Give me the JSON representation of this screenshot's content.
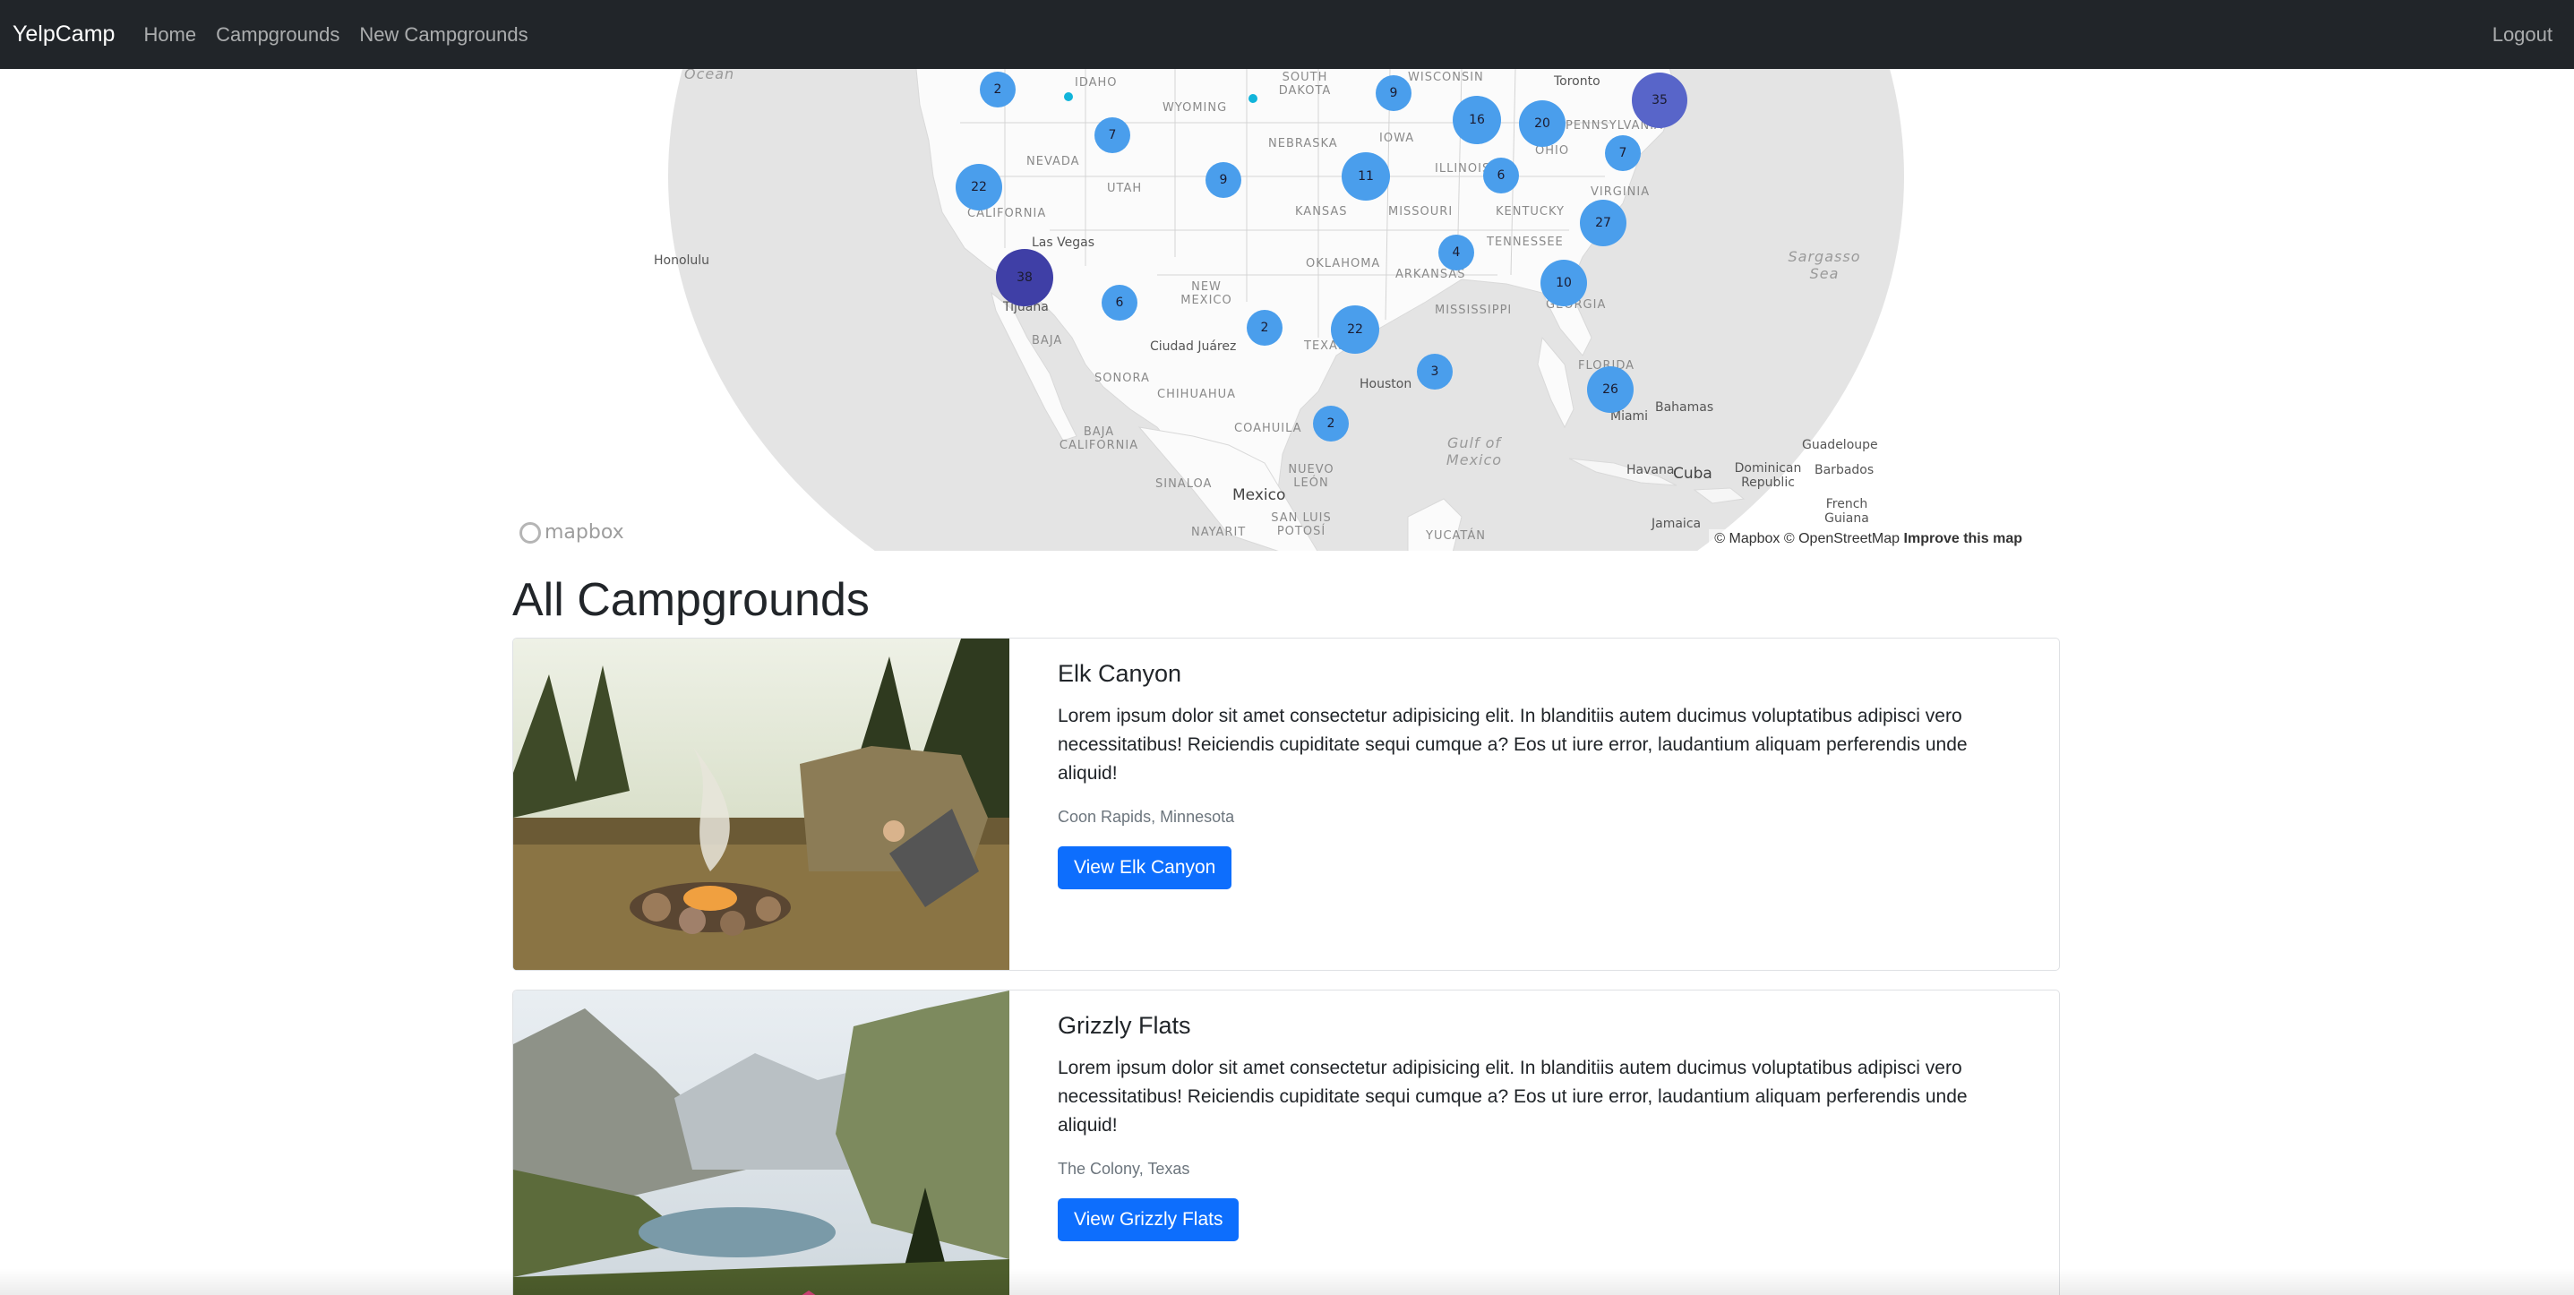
{
  "navbar": {
    "brand": "YelpCamp",
    "links": [
      "Home",
      "Campgrounds",
      "New Campgrounds"
    ],
    "logout": "Logout"
  },
  "map": {
    "labels": {
      "ocean": "Ocean",
      "idaho": "IDAHO",
      "wyoming": "WYOMING",
      "south_dakota": "SOUTH DAKOTA",
      "wisconsin": "WISCONSIN",
      "toronto": "Toronto",
      "nevada": "NEVADA",
      "utah": "UTAH",
      "nebraska": "NEBRASKA",
      "iowa": "IOWA",
      "illinois": "ILLINOIS",
      "pennsylvania": "PENNSYLVANIA",
      "ohio": "OHIO",
      "california": "CALIFORNIA",
      "kansas": "KANSAS",
      "missouri": "MISSOURI",
      "kentucky": "KENTUCKY",
      "virginia": "VIRGINIA",
      "honolulu": "Honolulu",
      "las_vegas": "Las Vegas",
      "oklahoma": "OKLAHOMA",
      "arkansas": "ARKANSAS",
      "tennessee": "TENNESSEE",
      "sargasso": "Sargasso Sea",
      "new_mexico": "NEW MEXICO",
      "mississippi": "MISSISSIPPI",
      "georgia": "GEORGIA",
      "tijuana": "Tijuana",
      "ciudad_juarez": "Ciudad Juárez",
      "texas": "TEXAS",
      "baja": "BAJA",
      "sonora": "SONORA",
      "chihuahua": "CHIHUAHUA",
      "houston": "Houston",
      "florida": "FLORIDA",
      "bahamas": "Bahamas",
      "miami": "Miami",
      "baja_california": "BAJA CALIFORNIA",
      "coahuila": "COAHUILA",
      "gulf": "Gulf of Mexico",
      "guadeloupe": "Guadeloupe",
      "nuevo_leon": "NUEVO LEÓN",
      "havana": "Havana",
      "cuba": "Cuba",
      "dominican": "Dominican Republic",
      "barbados": "Barbados",
      "sinaloa": "SINALOA",
      "mexico": "Mexico",
      "french_guiana": "French Guiana",
      "nayarit": "NAYARIT",
      "san_luis": "SAN LUIS POTOSÍ",
      "yucatan": "YUCATÁN",
      "jamaica": "Jamaica"
    },
    "clusters": [
      {
        "count": "2"
      },
      {
        "count": "9"
      },
      {
        "count": "35"
      },
      {
        "count": "16"
      },
      {
        "count": "20"
      },
      {
        "count": "7"
      },
      {
        "count": "22"
      },
      {
        "count": "9"
      },
      {
        "count": "11"
      },
      {
        "count": "6"
      },
      {
        "count": "7"
      },
      {
        "count": "27"
      },
      {
        "count": "38"
      },
      {
        "count": "4"
      },
      {
        "count": "6"
      },
      {
        "count": "10"
      },
      {
        "count": "2"
      },
      {
        "count": "22"
      },
      {
        "count": "3"
      },
      {
        "count": "26"
      },
      {
        "count": "2"
      }
    ],
    "logo": "mapbox",
    "attribution": "© Mapbox © OpenStreetMap",
    "improve": "Improve this map"
  },
  "page_title": "All Campgrounds",
  "campgrounds": [
    {
      "title": "Elk Canyon",
      "description": "Lorem ipsum dolor sit amet consectetur adipisicing elit. In blanditiis autem ducimus voluptatibus adipisci vero necessitatibus! Reiciendis cupiditate sequi cumque a? Eos ut iure error, laudantium aliquam perferendis unde aliquid!",
      "location": "Coon Rapids, Minnesota",
      "button": "View Elk Canyon"
    },
    {
      "title": "Grizzly Flats",
      "description": "Lorem ipsum dolor sit amet consectetur adipisicing elit. In blanditiis autem ducimus voluptatibus adipisci vero necessitatibus! Reiciendis cupiditate sequi cumque a? Eos ut iure error, laudantium aliquam perferendis unde aliquid!",
      "location": "The Colony, Texas",
      "button": "View Grizzly Flats"
    }
  ]
}
